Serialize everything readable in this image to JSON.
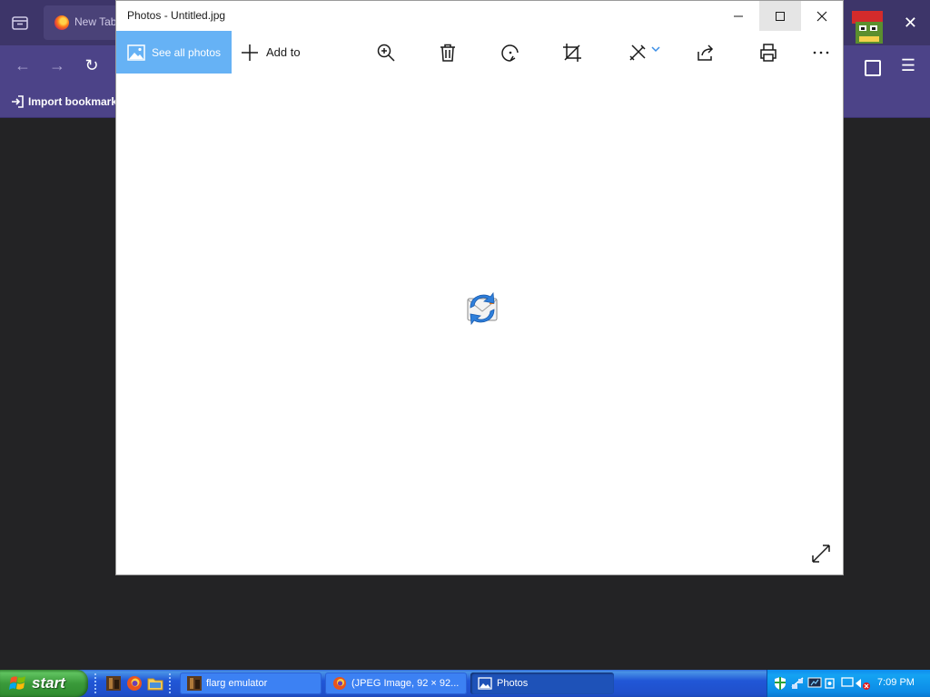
{
  "firefox": {
    "tab_title": "New Tab",
    "bookmarks_toolbar": {
      "import_label": "Import bookmarks..."
    },
    "colors": {
      "tabbar": "#3d3569",
      "toolbar": "#4c4388"
    }
  },
  "photos": {
    "window_title": "Photos - Untitled.jpg",
    "toolbar": {
      "see_all_label": "See all photos",
      "add_to_label": "Add to",
      "tools": [
        "zoom-icon",
        "delete-icon",
        "rotate-icon",
        "crop-icon",
        "edit-icon",
        "share-icon",
        "print-icon",
        "more-icon"
      ]
    },
    "image": {
      "icon": "mail-sync-icon"
    },
    "colors": {
      "accent": "#66b2f5"
    }
  },
  "taskbar": {
    "start_label": "start",
    "quick_launch": [
      "app-icon",
      "firefox-icon",
      "folder-icon"
    ],
    "tasks": [
      {
        "label": "flarg emulator",
        "icon": "app-icon",
        "active": false
      },
      {
        "label": "(JPEG Image, 92 × 92...",
        "icon": "firefox-icon",
        "active": false
      },
      {
        "label": "Photos",
        "icon": "photos-icon",
        "active": true
      }
    ],
    "tray_icons": [
      "security-shield-icon",
      "network-icon",
      "display-icon",
      "camera-icon",
      "network-disconnected-icon"
    ],
    "clock": "7:09 PM"
  }
}
